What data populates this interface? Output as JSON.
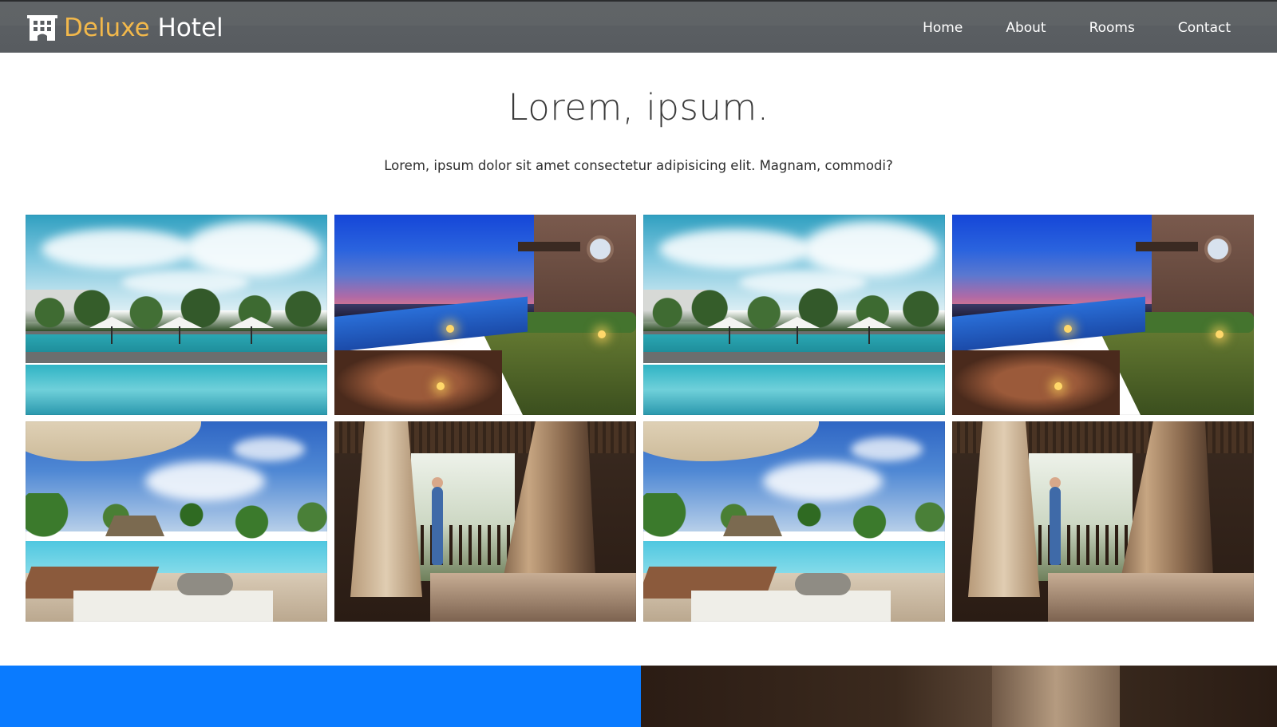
{
  "brand": {
    "name_accent": "Deluxe",
    "name_rest": " Hotel",
    "icon": "hotel-building-icon",
    "accent_color": "#f2b84b"
  },
  "nav": {
    "items": [
      "Home",
      "About",
      "Rooms",
      "Contact"
    ]
  },
  "intro": {
    "title": "Lorem, ipsum.",
    "subtitle": "Lorem, ipsum dolor sit amet consectetur adipisicing elit. Magnam, commodi?"
  },
  "gallery": {
    "images": [
      {
        "scene": "daytime hotel pool with umbrellas"
      },
      {
        "scene": "sunset terrace with infinity pool"
      },
      {
        "scene": "daytime hotel pool with umbrellas"
      },
      {
        "scene": "sunset terrace with infinity pool"
      },
      {
        "scene": "tropical pool with loungers and palms"
      },
      {
        "scene": "bedroom with canopy curtains and balcony"
      },
      {
        "scene": "tropical pool with loungers and palms"
      },
      {
        "scene": "bedroom with canopy curtains and balcony"
      }
    ]
  },
  "colors": {
    "navbar": "#5a5e62",
    "cta_block": "#0a7bff"
  }
}
